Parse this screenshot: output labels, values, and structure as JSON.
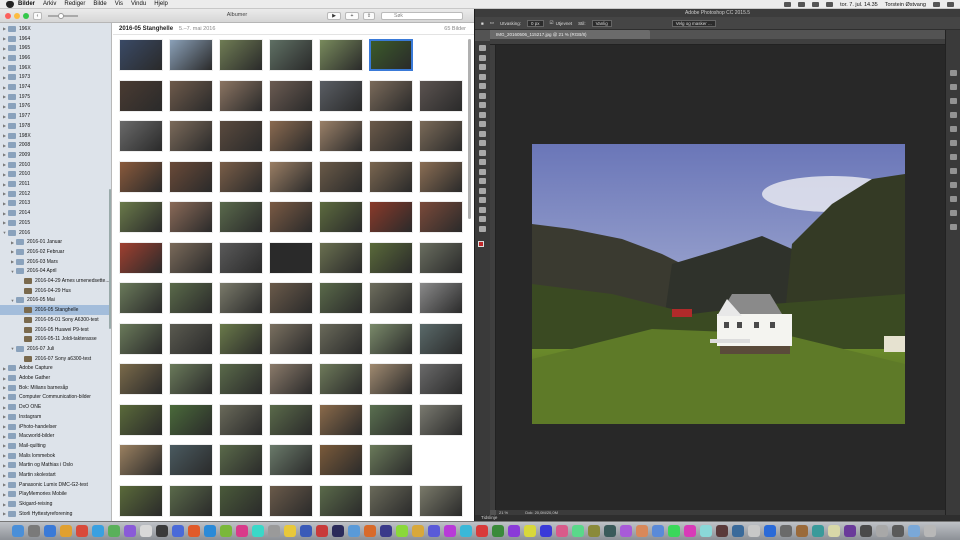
{
  "menubar": {
    "items": [
      "Bilder",
      "Arkiv",
      "Rediger",
      "Bilde",
      "Vis",
      "Vindu",
      "Hjelp"
    ],
    "datetime": "tor. 7. jul. 14.35",
    "user": "Torstein Østvang"
  },
  "photos": {
    "window_title": "Albumer",
    "search_placeholder": "Søk",
    "album_title": "2016-05 Stanghelle",
    "album_dates": "5.–7. mai 2016",
    "album_count": "65 Bilder",
    "sidebar": [
      {
        "label": "196X",
        "depth": 0
      },
      {
        "label": "1964",
        "depth": 0
      },
      {
        "label": "1965",
        "depth": 0
      },
      {
        "label": "1966",
        "depth": 0
      },
      {
        "label": "196X",
        "depth": 0
      },
      {
        "label": "1973",
        "depth": 0
      },
      {
        "label": "1974",
        "depth": 0
      },
      {
        "label": "1975",
        "depth": 0
      },
      {
        "label": "1976",
        "depth": 0
      },
      {
        "label": "1977",
        "depth": 0
      },
      {
        "label": "1978",
        "depth": 0
      },
      {
        "label": "198X",
        "depth": 0
      },
      {
        "label": "2008",
        "depth": 0
      },
      {
        "label": "2009",
        "depth": 0
      },
      {
        "label": "2010",
        "depth": 0
      },
      {
        "label": "2010",
        "depth": 0
      },
      {
        "label": "2011",
        "depth": 0
      },
      {
        "label": "2012",
        "depth": 0
      },
      {
        "label": "2013",
        "depth": 0
      },
      {
        "label": "2014",
        "depth": 0
      },
      {
        "label": "2015",
        "depth": 0
      },
      {
        "label": "2016",
        "depth": 0,
        "open": true
      },
      {
        "label": "2016-01 Januar",
        "depth": 1
      },
      {
        "label": "2016-02 Februar",
        "depth": 1
      },
      {
        "label": "2016-03 Mars",
        "depth": 1
      },
      {
        "label": "2016-04 April",
        "depth": 1,
        "open": true
      },
      {
        "label": "2016-04-29 Arnes urnenedsette...",
        "depth": 2
      },
      {
        "label": "2016-04-29 Hus",
        "depth": 2
      },
      {
        "label": "2016-05 Mai",
        "depth": 1,
        "open": true
      },
      {
        "label": "2016-05 Stanghelle",
        "depth": 2,
        "selected": true
      },
      {
        "label": "2016-05-01 Sony A6300-test",
        "depth": 2
      },
      {
        "label": "2016-05 Huawei P9-test",
        "depth": 2
      },
      {
        "label": "2016-05-11 Joldi-takterasse",
        "depth": 2
      },
      {
        "label": "2016-07 Juli",
        "depth": 1,
        "open": true
      },
      {
        "label": "2016-07 Sony a6300-test",
        "depth": 2
      },
      {
        "label": "Adobe Capture",
        "depth": 0
      },
      {
        "label": "Adobe Gather",
        "depth": 0
      },
      {
        "label": "Bok: Milians barnesåp",
        "depth": 0
      },
      {
        "label": "Computer Communication-bilder",
        "depth": 0
      },
      {
        "label": "DxO ONE",
        "depth": 0
      },
      {
        "label": "Instagram",
        "depth": 0
      },
      {
        "label": "iPhoto-handelser",
        "depth": 0
      },
      {
        "label": "Macworld-bilder",
        "depth": 0
      },
      {
        "label": "Mail-quilting",
        "depth": 0
      },
      {
        "label": "Malis lommebok",
        "depth": 0
      },
      {
        "label": "Martin og Mathias i Oslo",
        "depth": 0
      },
      {
        "label": "Martin skolestart",
        "depth": 0
      },
      {
        "label": "Panasonic Lumix DMC-G2-test",
        "depth": 0
      },
      {
        "label": "PlayMemories Mobile",
        "depth": 0
      },
      {
        "label": "Skigard-reising",
        "depth": 0
      },
      {
        "label": "Storli Hyttestyreforening",
        "depth": 0
      }
    ],
    "photo_colors": [
      [
        "#3a4a66",
        "#8aa0b8",
        "#6f7c54",
        "#5f7064",
        "#788a5c",
        "#3b5b2a"
      ],
      [
        "#4a3b32",
        "#6e5a4b",
        "#8b7462",
        "#6b5b52",
        "#5a5e64",
        "#7a6a5a",
        "#5b5350"
      ],
      [
        "#6a6a6a",
        "#7b6a5a",
        "#5a4a3e",
        "#8a6a50",
        "#9a8068",
        "#6b5a4a",
        "#7a6a58"
      ],
      [
        "#8a5a3c",
        "#6a4a38",
        "#7a5e48",
        "#9a7e64",
        "#6a5a48",
        "#7a6650",
        "#8b6e54"
      ],
      [
        "#6a7a4a",
        "#8a6a58",
        "#5a6a4c",
        "#7a5a44",
        "#5d6b3f",
        "#8a3a2a",
        "#7b4a3a"
      ],
      [
        "#a04030",
        "#7a6a5a",
        "#5a5a5a",
        "#2a2a2a",
        "#6a7050",
        "#5a6a3a",
        "#6a6e60"
      ],
      [
        "#6a7a5a",
        "#5a6a4a",
        "#7a7a6a",
        "#6a5a4a",
        "#5a6a4a",
        "#6e6e5e",
        "#8a8a8a"
      ],
      [
        "#6a7a5a",
        "#5a5a50",
        "#6a7a4a",
        "#7a7060",
        "#6a6a5a",
        "#7a8a6a",
        "#5a6a6a"
      ],
      [
        "#7a6a4a",
        "#6a7a5a",
        "#5a6a4a",
        "#8a7a6a",
        "#6e7a5a",
        "#a08a70",
        "#6a6a6a"
      ],
      [
        "#5a6a3a",
        "#4a6a3a",
        "#6a6a5a",
        "#5a6a4a",
        "#8a6a4a",
        "#5a7050",
        "#7a7a70"
      ],
      [
        "#9a8060",
        "#4a5a60",
        "#5a6a4a",
        "#6a7a6a",
        "#7a5a3a",
        "#6a7a5a"
      ],
      [
        "#5a6a3a",
        "#5a6a4a",
        "#4a5a3a",
        "#6a5a4a",
        "#5a6a4a",
        "#6a6a5a",
        "#7a7a6a"
      ]
    ]
  },
  "photoshop": {
    "app_title": "Adobe Photoshop CC 2015.5",
    "doc_tab": "IMG_20160506_115217.jpg @ 21 % (RGB/8)",
    "options": {
      "feather_label": "Utvasking:",
      "feather_value": "0 px",
      "antialias": "Utjevnet",
      "style_label": "Stil:",
      "style_value": "Vanlig",
      "select_mask": "Velg og masker ..."
    },
    "zoom": "21 %",
    "doc_info": "Dok: 20,0M/20,0M",
    "timeline": "Tidslinje"
  },
  "dock": {
    "colors": [
      "#4a8fd8",
      "#7a7a7a",
      "#3a7ad8",
      "#e0a030",
      "#d84a3a",
      "#3aa0e0",
      "#5ab05a",
      "#8a5ad8",
      "#d8d8d8",
      "#3a3a3a",
      "#4a6ad8",
      "#e05a2a",
      "#2a8ad8",
      "#7ab83a",
      "#d83a8a",
      "#3ad8c8",
      "#9a9a9a",
      "#e8c83a",
      "#3a5ab8",
      "#c83a3a",
      "#2a2a5a",
      "#5a9ad8",
      "#d86a2a",
      "#3a3a8a",
      "#8ad83a",
      "#d8a83a",
      "#5a5ad8",
      "#b83ad8",
      "#3ab8d8",
      "#d83a3a",
      "#3a8a3a",
      "#8a3ad8",
      "#d8d83a",
      "#3a3ad8",
      "#d85a8a",
      "#5ad88a",
      "#8a8a3a",
      "#3a5a5a",
      "#a85ad8",
      "#d8885a",
      "#5a8ad8",
      "#3ad85a",
      "#d83ab8",
      "#8ad8d8",
      "#5a3a3a",
      "#3a6a9a",
      "#c8c8c8",
      "#2a6ad8",
      "#6a6a6a",
      "#9a6a3a",
      "#3a9a9a",
      "#d8d8a8",
      "#6a3a9a",
      "#4a4a4a",
      "#a8a8a8",
      "#5a5a5a",
      "#7aa8d8",
      "#b8b8b8"
    ]
  }
}
